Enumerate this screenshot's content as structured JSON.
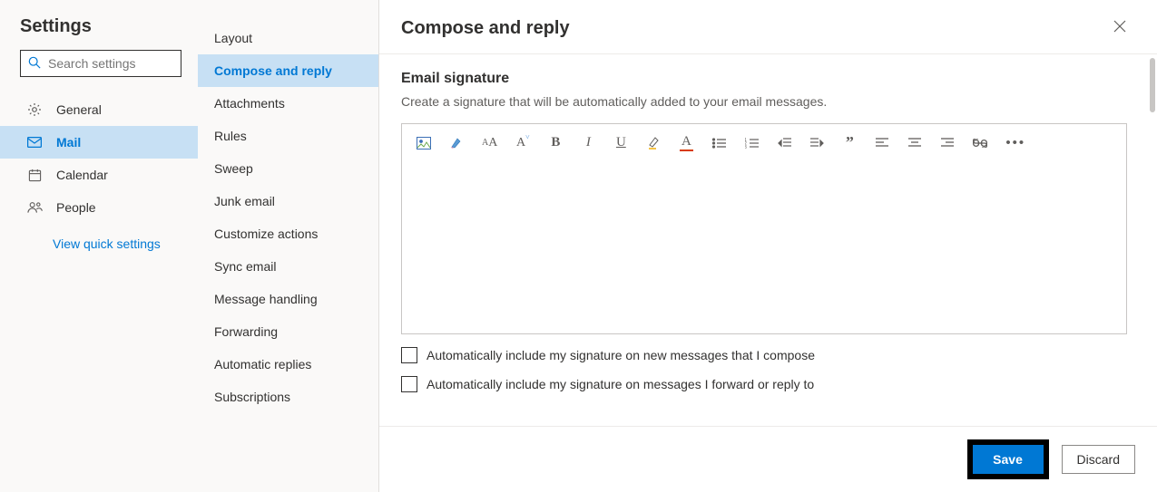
{
  "settings": {
    "title": "Settings",
    "search_placeholder": "Search settings",
    "nav": [
      {
        "label": "General"
      },
      {
        "label": "Mail"
      },
      {
        "label": "Calendar"
      },
      {
        "label": "People"
      }
    ],
    "quick_link": "View quick settings"
  },
  "subnav": {
    "items": [
      {
        "label": "Layout"
      },
      {
        "label": "Compose and reply"
      },
      {
        "label": "Attachments"
      },
      {
        "label": "Rules"
      },
      {
        "label": "Sweep"
      },
      {
        "label": "Junk email"
      },
      {
        "label": "Customize actions"
      },
      {
        "label": "Sync email"
      },
      {
        "label": "Message handling"
      },
      {
        "label": "Forwarding"
      },
      {
        "label": "Automatic replies"
      },
      {
        "label": "Subscriptions"
      }
    ]
  },
  "panel": {
    "title": "Compose and reply",
    "section_title": "Email signature",
    "section_desc": "Create a signature that will be automatically added to your email messages.",
    "checkbox1": "Automatically include my signature on new messages that I compose",
    "checkbox2": "Automatically include my signature on messages I forward or reply to",
    "save_label": "Save",
    "discard_label": "Discard"
  },
  "toolbar_icons": [
    "insert-image-icon",
    "formatting-icon",
    "font-case-icon",
    "font-size-icon",
    "bold-icon",
    "italic-icon",
    "underline-icon",
    "highlight-icon",
    "font-color-icon",
    "bullets-icon",
    "numbering-icon",
    "outdent-icon",
    "indent-icon",
    "quote-icon",
    "align-left-icon",
    "align-center-icon",
    "align-right-icon",
    "link-icon",
    "more-icon"
  ]
}
